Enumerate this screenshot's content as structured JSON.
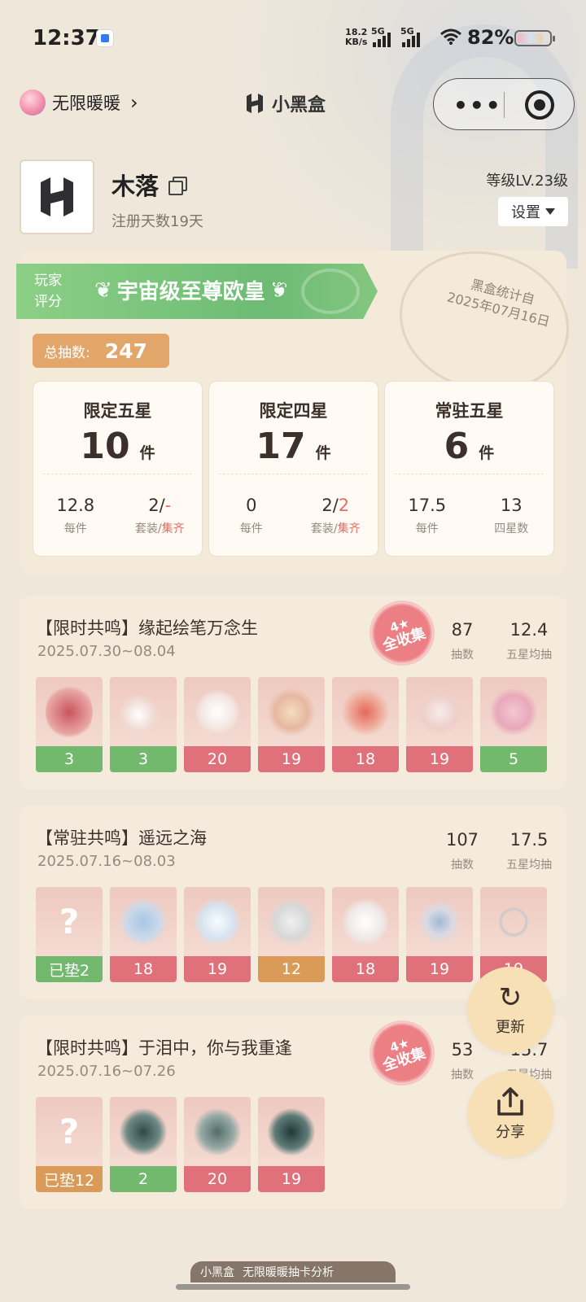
{
  "status_bar": {
    "time": "12:37",
    "net_speed_value": "18.2",
    "net_speed_unit": "KB/s",
    "signal1": "5G",
    "signal2": "5G",
    "battery": "82%"
  },
  "header": {
    "game_name": "无限暖暖",
    "app_title": "小黑盒"
  },
  "profile": {
    "name": "木落",
    "registered": "注册天数19天",
    "level": "等级LV.23级",
    "settings_label": "设置"
  },
  "summary": {
    "rating_label_1": "玩家",
    "rating_label_2": "评分",
    "rating_title": "宇宙级至尊欧皇",
    "stamp_line1": "黑盒统计自",
    "stamp_line2": "2025年07月16日",
    "total_label": "总抽数:",
    "total_value": "247",
    "unit": "件",
    "stats": [
      {
        "title": "限定五星",
        "value": "10",
        "left_value": "12.8",
        "left_label": "每件",
        "right_value_a": "2/",
        "right_value_b": "-",
        "right_label_a": "套装/",
        "right_label_b": "集齐"
      },
      {
        "title": "限定四星",
        "value": "17",
        "left_value": "0",
        "left_label": "每件",
        "right_value_a": "2/",
        "right_value_b": "2",
        "right_label_a": "套装/",
        "right_label_b": "集齐"
      },
      {
        "title": "常驻五星",
        "value": "6",
        "left_value": "17.5",
        "left_label": "每件",
        "right_value_a": "13",
        "right_value_b": "",
        "right_label_a": "四星数",
        "right_label_b": ""
      }
    ]
  },
  "sections": [
    {
      "title": "【限时共鸣】缘起绘笔万念生",
      "date": "2025.07.30~08.04",
      "badge_line1": "4★",
      "badge_line2": "全收集",
      "pulls": "87",
      "pulls_label": "抽数",
      "avg": "12.4",
      "avg_label": "五星均抽",
      "items": [
        "3",
        "3",
        "20",
        "19",
        "18",
        "19",
        "5"
      ]
    },
    {
      "title": "【常驻共鸣】遥远之海",
      "date": "2025.07.16~08.03",
      "pulls": "107",
      "pulls_label": "抽数",
      "avg": "17.5",
      "avg_label": "五星均抽",
      "unknown_mark": "?",
      "items": [
        "已垫2",
        "18",
        "19",
        "12",
        "18",
        "19",
        "19"
      ]
    },
    {
      "title": "【限时共鸣】于泪中，你与我重逢",
      "date": "2025.07.16~07.26",
      "badge_line1": "4★",
      "badge_line2": "全收集",
      "pulls": "53",
      "pulls_label": "抽数",
      "avg": "15.7",
      "avg_label": "五星均抽",
      "unknown_mark": "?",
      "items": [
        "已垫12",
        "2",
        "20",
        "19"
      ]
    }
  ],
  "fab": {
    "refresh_label": "更新",
    "share_label": "分享"
  },
  "bottom": {
    "brand": "小黑盒",
    "text": "无限暖暖抽卡分析"
  },
  "colors": {
    "green": "#73b96d",
    "red": "#e0717a",
    "orange": "#d99b57",
    "accent_total": "#e2a66b",
    "badge_pink": "#ec7f84"
  }
}
